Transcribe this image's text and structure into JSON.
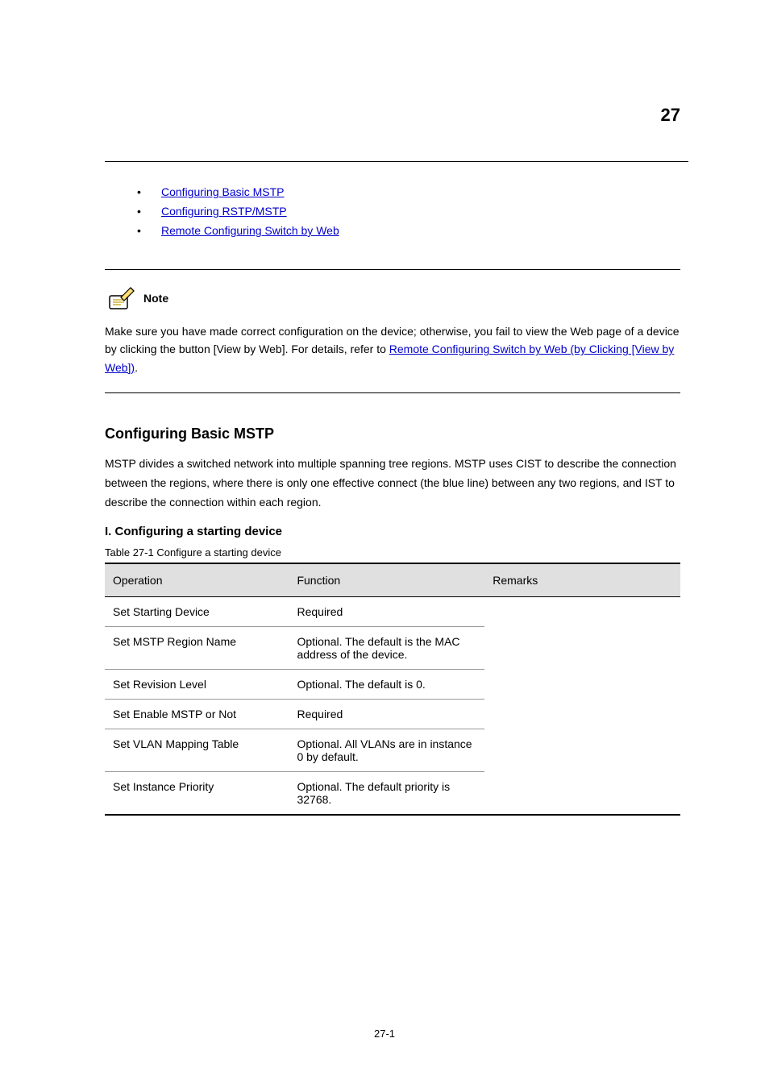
{
  "page_number_top": "27",
  "bullets": [
    {
      "label": "Configuring Basic MSTP"
    },
    {
      "label": "Configuring RSTP/MSTP"
    },
    {
      "label": "Remote Configuring Switch by Web"
    }
  ],
  "note": {
    "label": "Note",
    "text_before": "Make sure you have made correct configuration on the device; otherwise, you fail to view the Web page of a device by clicking the button [View by Web]. For details, refer to ",
    "link": "Remote Configuring Switch by Web (by Clicking [View by Web])",
    "text_after": "."
  },
  "section": {
    "heading": "Configuring Basic MSTP",
    "paragraph": "MSTP divides a switched network into multiple spanning tree regions. MSTP uses CIST to describe the connection between the regions, where there is only one effective connect (the blue line) between any two regions, and IST to describe the connection within each region.",
    "subheading": "I. Configuring a starting device"
  },
  "table": {
    "caption": "Table 27-1 Configure a starting device",
    "headers": [
      "Operation",
      "Function",
      "Remarks"
    ],
    "rows": [
      {
        "op": "Set Starting Device",
        "fn": "Required",
        "rm": ""
      },
      {
        "op": "Set MSTP Region Name",
        "fn": "",
        "rm": "Optional. The default is the MAC address of the device."
      },
      {
        "op": "Set Revision Level",
        "fn": "",
        "rm": "Optional. The default is 0."
      },
      {
        "op": "Set Enable MSTP or Not",
        "fn": "Required",
        "rm": ""
      },
      {
        "op": "Set VLAN Mapping Table",
        "fn": "",
        "rm": "Optional. All VLANs are in instance 0 by default."
      },
      {
        "op": "Set Instance Priority",
        "fn": "",
        "rm": "Optional. The default priority is 32768."
      }
    ]
  },
  "footer": "27-1"
}
